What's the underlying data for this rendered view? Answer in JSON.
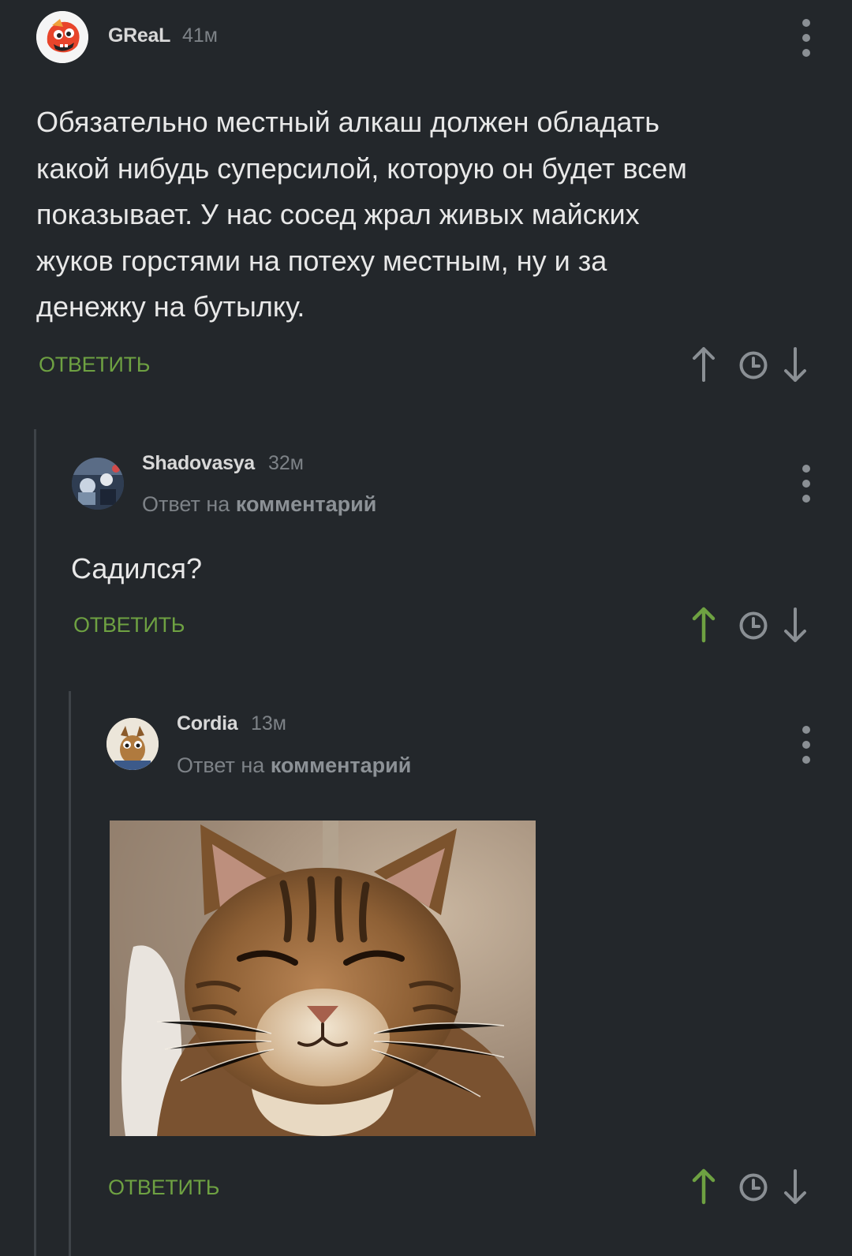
{
  "comments": [
    {
      "username": "GReaL",
      "time": "41м",
      "text_lines": [
        "Обязательно местный алкаш должен обладать",
        "какой нибудь суперсилой, которую он будет всем",
        "показывает. У нас сосед жрал живых майских",
        "жуков горстями на потеху местным, ну и за",
        "денежку на бутылку."
      ],
      "reply_label": "ОТВЕТИТЬ",
      "upvoted": false
    },
    {
      "username": "Shadovasya",
      "time": "32м",
      "reply_prefix": "Ответ на",
      "reply_target": "комментарий",
      "text": "Садился?",
      "reply_label": "ОТВЕТИТЬ",
      "upvoted": true
    },
    {
      "username": "Cordia",
      "time": "13м",
      "reply_prefix": "Ответ на",
      "reply_target": "комментарий",
      "image": "cat-photo",
      "reply_label": "ОТВЕТИТЬ",
      "upvoted": true
    }
  ],
  "colors": {
    "background": "#23272b",
    "accent_green": "#6ea142",
    "icon_gray": "#8a8f94",
    "thread_line": "#3e4348"
  }
}
